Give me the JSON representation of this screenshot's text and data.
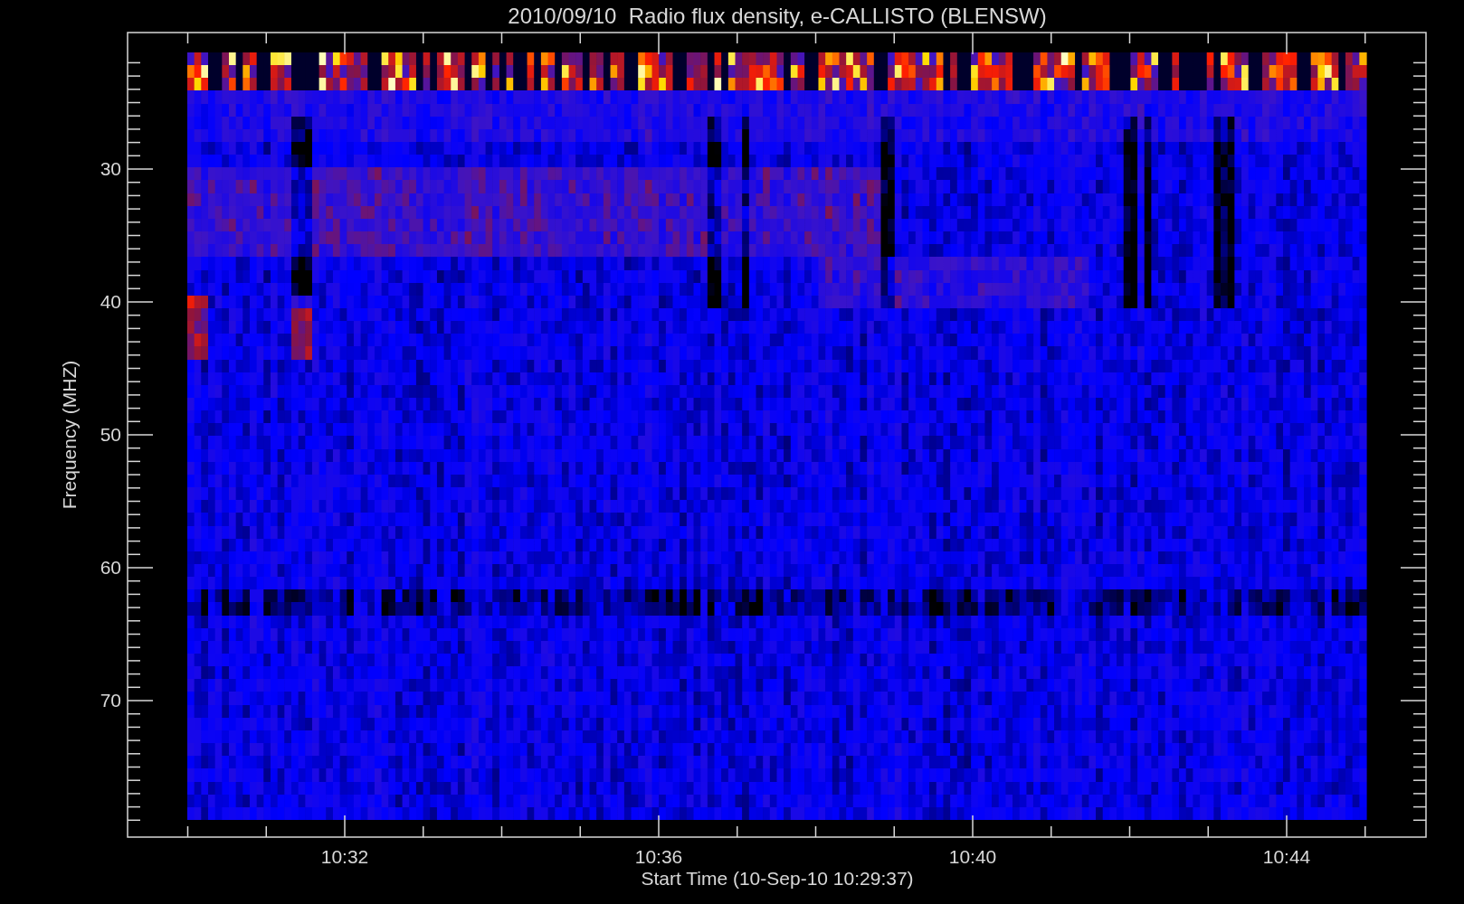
{
  "title": "2010/09/10  Radio flux density, e-CALLISTO (BLENSW)",
  "y_axis": {
    "label": "Frequency (MHZ)",
    "ticks": [
      "30",
      "40",
      "50",
      "60",
      "70"
    ]
  },
  "x_axis": {
    "label": "Start Time (10-Sep-10 10:29:37)",
    "ticks": [
      "10:32",
      "10:36",
      "10:40",
      "10:44"
    ]
  }
}
